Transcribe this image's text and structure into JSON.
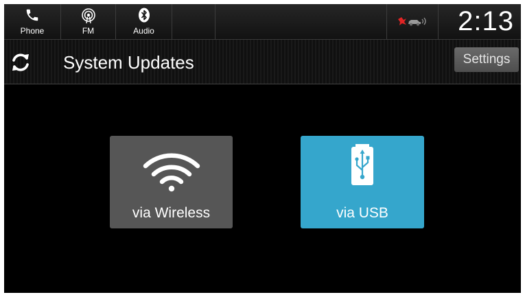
{
  "status_bar": {
    "tabs": [
      {
        "label": "Phone",
        "icon": "phone-icon"
      },
      {
        "label": "FM",
        "icon": "radio-icon"
      },
      {
        "label": "Audio",
        "icon": "bluetooth-icon"
      }
    ],
    "alert_icon": "car-alert-icon",
    "clock": "2:13"
  },
  "header": {
    "icon": "refresh-icon",
    "title": "System Updates",
    "settings_label": "Settings"
  },
  "options": [
    {
      "label": "via Wireless",
      "icon": "wifi-icon",
      "color": "#565656"
    },
    {
      "label": "via USB",
      "icon": "usb-icon",
      "color": "#35a6cc"
    }
  ],
  "colors": {
    "background": "#000000",
    "accent": "#35a6cc"
  }
}
